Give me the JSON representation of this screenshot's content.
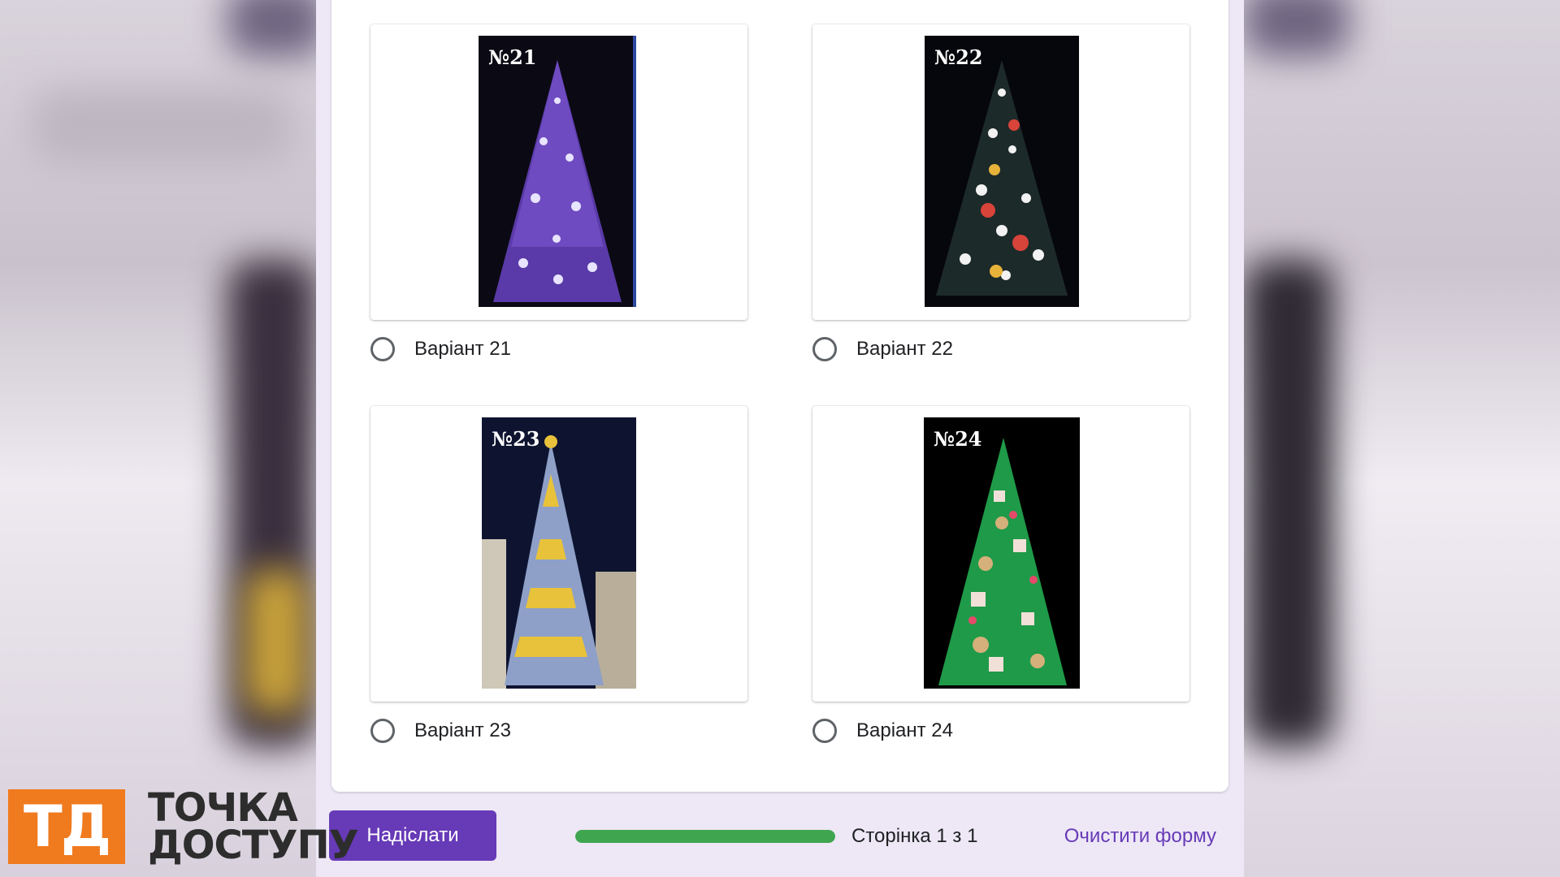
{
  "options": [
    {
      "number_label": "№21",
      "label": "Варіант 21"
    },
    {
      "number_label": "№22",
      "label": "Варіант 22"
    },
    {
      "number_label": "№23",
      "label": "Варіант 23"
    },
    {
      "number_label": "№24",
      "label": "Варіант 24"
    }
  ],
  "footer": {
    "submit_label": "Надіслати",
    "progress_percent": 100,
    "page_text": "Сторінка 1 з 1",
    "clear_label": "Очистити форму"
  },
  "logo": {
    "mark": "ТД",
    "line1": "ТОЧКА",
    "line2": "ДОСТУПУ"
  },
  "colors": {
    "accent": "#673ab7",
    "progress": "#3fa64f",
    "page_bg": "#ede7f6",
    "logo_orange": "#f07a1e"
  }
}
